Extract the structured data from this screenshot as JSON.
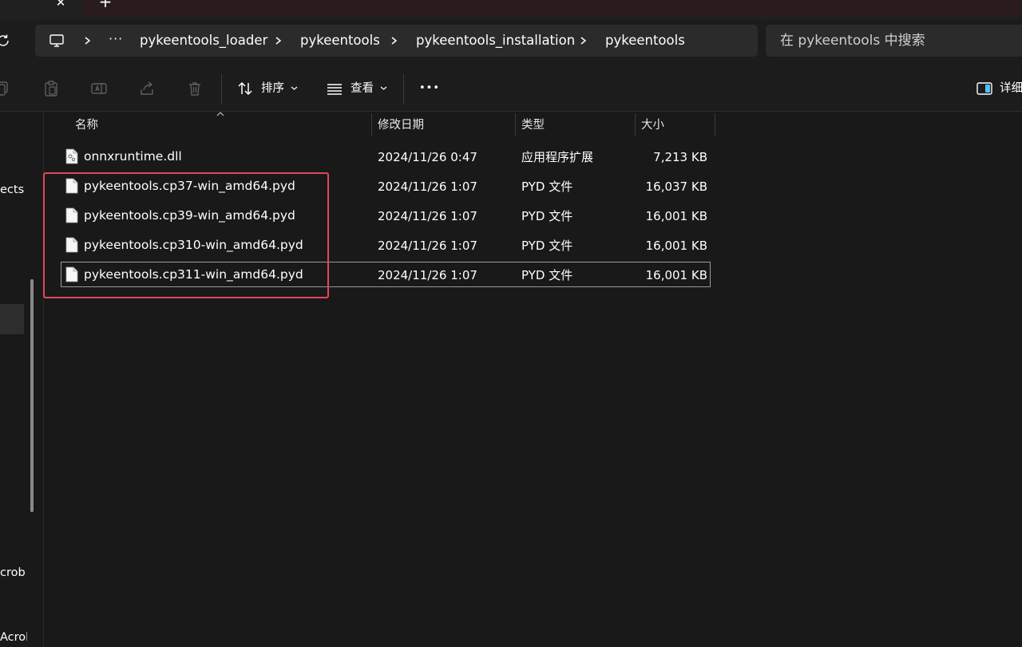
{
  "titlebar": {
    "close_glyph": "✕",
    "new_tab_glyph": "+"
  },
  "address": {
    "ellipsis": "···",
    "crumbs": [
      "pykeentools_loader",
      "pykeentools",
      "pykeentools_installation",
      "pykeentools"
    ]
  },
  "search": {
    "placeholder": "在 pykeentools 中搜索"
  },
  "toolbar": {
    "sort_label": "排序",
    "view_label": "查看",
    "more_label": "•••",
    "details_label": "详细"
  },
  "nav": {
    "items": [
      "ects E",
      "crob",
      "Acrol"
    ]
  },
  "columns": {
    "name": "名称",
    "modified": "修改日期",
    "type": "类型",
    "size": "大小"
  },
  "files": [
    {
      "name": "onnxruntime.dll",
      "modified": "2024/11/26 0:47",
      "type": "应用程序扩展",
      "size": "7,213 KB",
      "icon": "dll-file-icon"
    },
    {
      "name": "pykeentools.cp37-win_amd64.pyd",
      "modified": "2024/11/26 1:07",
      "type": "PYD 文件",
      "size": "16,037 KB",
      "icon": "file-icon"
    },
    {
      "name": "pykeentools.cp39-win_amd64.pyd",
      "modified": "2024/11/26 1:07",
      "type": "PYD 文件",
      "size": "16,001 KB",
      "icon": "file-icon"
    },
    {
      "name": "pykeentools.cp310-win_amd64.pyd",
      "modified": "2024/11/26 1:07",
      "type": "PYD 文件",
      "size": "16,001 KB",
      "icon": "file-icon"
    },
    {
      "name": "pykeentools.cp311-win_amd64.pyd",
      "modified": "2024/11/26 1:07",
      "type": "PYD 文件",
      "size": "16,001 KB",
      "icon": "file-icon"
    }
  ],
  "colors": {
    "highlight": "#e5455a",
    "background": "#191919",
    "panel": "#2b2b2b"
  }
}
